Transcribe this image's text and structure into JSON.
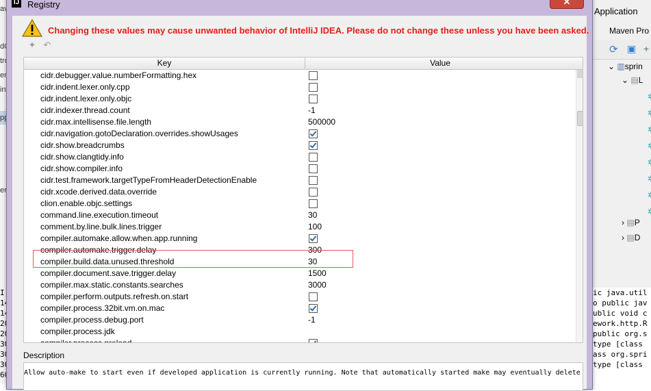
{
  "background": {
    "right_menu": "Application",
    "maven_title": "Maven Pro",
    "tree": [
      "sprin",
      "L",
      "P",
      "D"
    ],
    "left_fragments": [
      "av",
      "dC",
      "tro",
      "em",
      "int",
      "pp",
      "ert"
    ],
    "left_numbers": [
      "I",
      "14",
      "14",
      "20",
      "20",
      "30",
      "30",
      "30",
      "60"
    ],
    "console_lines": [
      "ic java.util",
      "o public jav",
      "ublic void c",
      "ework.http.R",
      "public org.s",
      "type [class",
      "ass org.spri",
      "type [class"
    ]
  },
  "dialog": {
    "title": "Registry",
    "close_glyph": "✕",
    "warning": "Changing these values may cause unwanted behavior of IntelliJ IDEA. Please do not change these unless you have been asked.",
    "toolbar": {
      "apply_icon": "puzzle-icon",
      "revert_icon": "undo-icon"
    },
    "columns": {
      "key": "Key",
      "value": "Value"
    },
    "rows": [
      {
        "key": "cidr.debugger.value.numberFormatting.hex",
        "type": "bool",
        "checked": false
      },
      {
        "key": "cidr.indent.lexer.only.cpp",
        "type": "bool",
        "checked": false
      },
      {
        "key": "cidr.indent.lexer.only.objc",
        "type": "bool",
        "checked": false
      },
      {
        "key": "cidr.indexer.thread.count",
        "type": "text",
        "value": "-1"
      },
      {
        "key": "cidr.max.intellisense.file.length",
        "type": "text",
        "value": "500000"
      },
      {
        "key": "cidr.navigation.gotoDeclaration.overrides.showUsages",
        "type": "bool",
        "checked": true
      },
      {
        "key": "cidr.show.breadcrumbs",
        "type": "bool",
        "checked": true
      },
      {
        "key": "cidr.show.clangtidy.info",
        "type": "bool",
        "checked": false
      },
      {
        "key": "cidr.show.compiler.info",
        "type": "bool",
        "checked": false
      },
      {
        "key": "cidr.test.framework.targetTypeFromHeaderDetectionEnable",
        "type": "bool",
        "checked": false
      },
      {
        "key": "cidr.xcode.derived.data.override",
        "type": "bool",
        "checked": false
      },
      {
        "key": "clion.enable.objc.settings",
        "type": "bool",
        "checked": false
      },
      {
        "key": "command.line.execution.timeout",
        "type": "text",
        "value": "30"
      },
      {
        "key": "comment.by.line.bulk.lines.trigger",
        "type": "text",
        "value": "100"
      },
      {
        "key": "compiler.automake.allow.when.app.running",
        "type": "bool",
        "checked": true
      },
      {
        "key": "compiler.automake.trigger.delay",
        "type": "text",
        "value": "300"
      },
      {
        "key": "compiler.build.data.unused.threshold",
        "type": "text",
        "value": "30"
      },
      {
        "key": "compiler.document.save.trigger.delay",
        "type": "text",
        "value": "1500"
      },
      {
        "key": "compiler.max.static.constants.searches",
        "type": "text",
        "value": "3000"
      },
      {
        "key": "compiler.perform.outputs.refresh.on.start",
        "type": "bool",
        "checked": false
      },
      {
        "key": "compiler.process.32bit.vm.on.mac",
        "type": "bool",
        "checked": true
      },
      {
        "key": "compiler.process.debug.port",
        "type": "text",
        "value": "-1"
      },
      {
        "key": "compiler.process.jdk",
        "type": "text",
        "value": ""
      },
      {
        "key": "compiler.process.preload",
        "type": "bool",
        "checked": true
      }
    ],
    "description_label": "Description",
    "description_text": "Allow auto-make to start even if developed application is currently running. Note that automatically started make may eventually delete"
  },
  "colors": {
    "warning_red": "#e0201a",
    "dialog_frame": "#c6b8db",
    "highlight_border": "#e8555a",
    "check_blue": "#2e6da4"
  }
}
